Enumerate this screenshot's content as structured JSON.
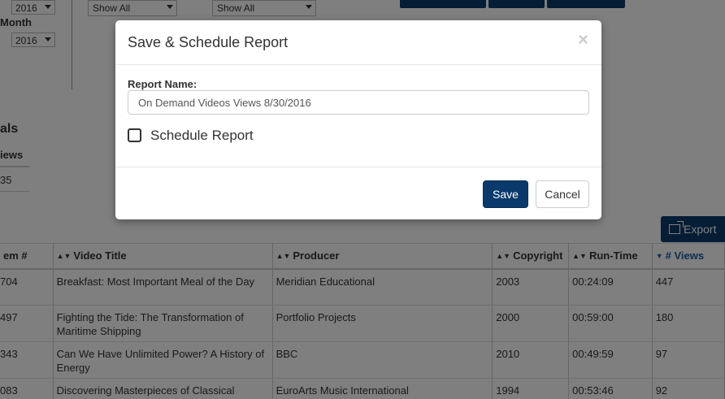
{
  "filters": {
    "year_value": "2016",
    "month_label": "Month",
    "month_year_value": "2016",
    "show_all_1": "Show All",
    "show_all_2": "Show All"
  },
  "totals": {
    "title": "als",
    "header": "iews",
    "value": "35"
  },
  "export_button": {
    "label": "Export",
    "icon": "external-link-icon"
  },
  "table": {
    "columns": [
      "em #",
      "Video Title",
      "Producer",
      "Copyright",
      "Run-Time",
      "# Views"
    ],
    "sorted_column": "# Views",
    "rows": [
      {
        "item": "704",
        "title": "Breakfast: Most Important Meal of the Day",
        "producer": "Meridian Educational",
        "copyright": "2003",
        "runtime": "00:24:09",
        "views": "447"
      },
      {
        "item": "497",
        "title": "Fighting the Tide: The Transformation of Maritime Shipping",
        "producer": "Portfolio Projects",
        "copyright": "2000",
        "runtime": "00:59:00",
        "views": "180"
      },
      {
        "item": "343",
        "title": "Can We Have Unlimited Power? A History of Energy",
        "producer": "BBC",
        "copyright": "2010",
        "runtime": "00:49:59",
        "views": "97"
      },
      {
        "item": "083",
        "title": "Discovering Masterpieces of Classical",
        "producer": "EuroArts Music International",
        "copyright": "1994",
        "runtime": "00:53:46",
        "views": "92"
      }
    ]
  },
  "modal": {
    "title": "Save & Schedule Report",
    "close_glyph": "×",
    "report_name_label": "Report Name:",
    "report_name_value": "On Demand Videos Views 8/30/2016",
    "schedule_label": "Schedule Report",
    "schedule_checked": false,
    "save_label": "Save",
    "cancel_label": "Cancel"
  },
  "colors": {
    "primary": "#0a3a6b",
    "sorted_header": "#1a5aa8"
  }
}
